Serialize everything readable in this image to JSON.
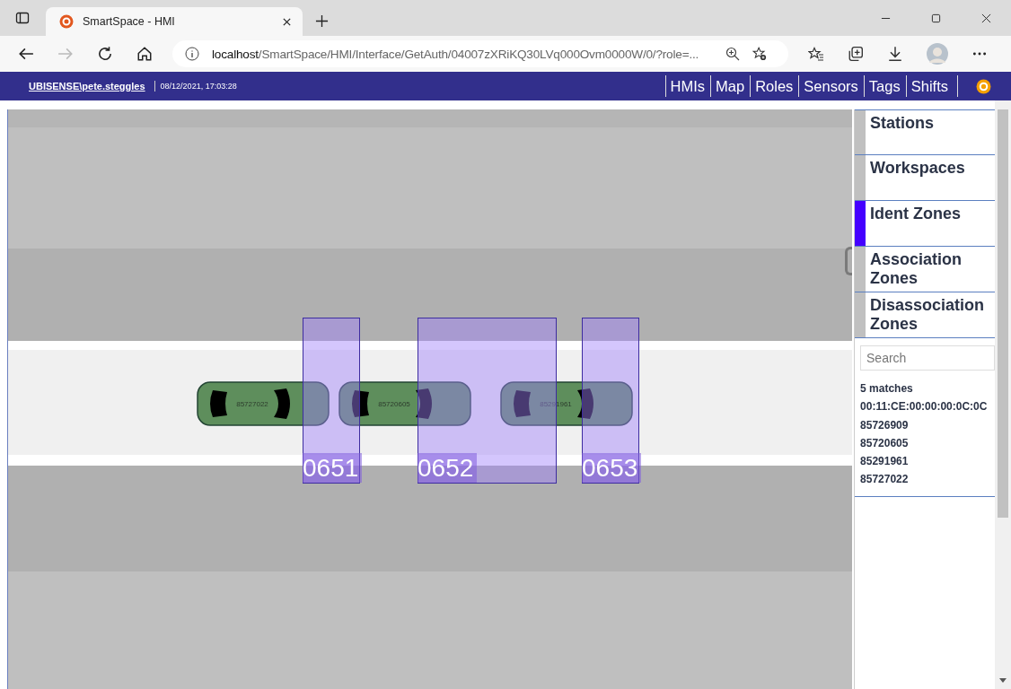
{
  "browser": {
    "tab_title": "SmartSpace - HMI",
    "url_host": "localhost",
    "url_path": "/SmartSpace/HMI/Interface/GetAuth/04007zXRiKQ30LVq000Ovm0000W/0/?role=..."
  },
  "header": {
    "user": "UBISENSE\\pete.steggles",
    "datetime": "08/12/2021, 17:03:28",
    "nav": [
      {
        "label": "HMIs"
      },
      {
        "label": "Map"
      },
      {
        "label": "Roles"
      },
      {
        "label": "Sensors"
      },
      {
        "label": "Tags"
      },
      {
        "label": "Shifts"
      }
    ]
  },
  "map": {
    "zones": [
      {
        "label": "0651"
      },
      {
        "label": "0652"
      },
      {
        "label": "0653"
      }
    ],
    "cars": [
      {
        "id": "85727022"
      },
      {
        "id": "85720605"
      },
      {
        "id": "85291961"
      }
    ]
  },
  "sidebar": {
    "categories": [
      {
        "label": "Stations",
        "selected": false
      },
      {
        "label": "Workspaces",
        "selected": false
      },
      {
        "label": "Ident Zones",
        "selected": true
      },
      {
        "label": "Association Zones",
        "selected": false
      },
      {
        "label": "Disassociation Zones",
        "selected": false
      }
    ],
    "search": {
      "placeholder": "Search"
    },
    "results_count": "5 matches",
    "results": [
      "00:11:CE:00:00:00:0C:0C",
      "85726909",
      "85720605",
      "85291961",
      "85727022"
    ]
  }
}
